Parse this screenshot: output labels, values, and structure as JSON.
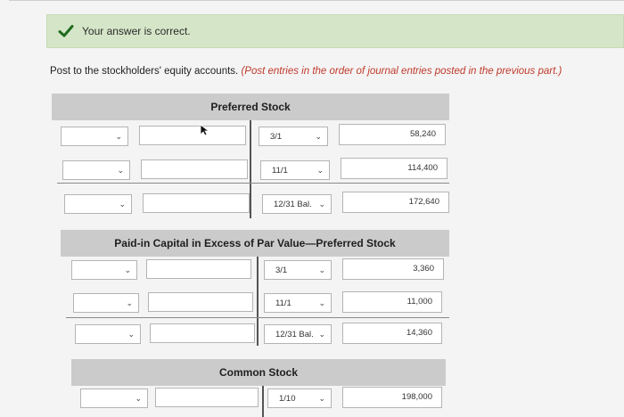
{
  "status": {
    "message": "Your answer is correct.",
    "icon": "check-icon",
    "color": "#1e6b1e"
  },
  "instructions": {
    "main": "Post to the stockholders' equity accounts.",
    "note": "(Post entries in the order of journal entries posted in the previous part.)"
  },
  "accounts": [
    {
      "title": "Preferred Stock",
      "rows": [
        {
          "date": "3/1",
          "amount": "58,240"
        },
        {
          "date": "11/1",
          "amount": "114,400"
        },
        {
          "date": "12/31 Bal.",
          "amount": "172,640"
        }
      ]
    },
    {
      "title": "Paid-in Capital in Excess of Par Value—Preferred Stock",
      "rows": [
        {
          "date": "3/1",
          "amount": "3,360"
        },
        {
          "date": "11/1",
          "amount": "11,000"
        },
        {
          "date": "12/31 Bal.",
          "amount": "14,360"
        }
      ]
    },
    {
      "title": "Common Stock",
      "rows": [
        {
          "date": "1/10",
          "amount": "198,000"
        }
      ]
    }
  ]
}
